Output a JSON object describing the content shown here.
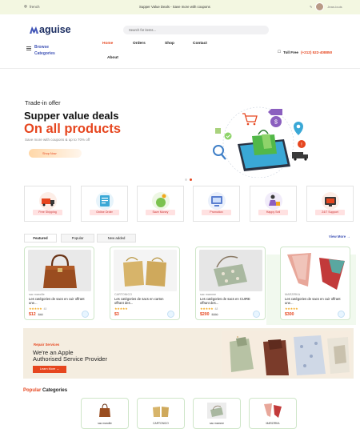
{
  "topbar": {
    "language": "french",
    "promo": "Supper Value Deals - Save more with coupons",
    "user": "Jean-louis"
  },
  "header": {
    "logo_text": "aguise",
    "search_placeholder": "Search for items...",
    "browse_label_1": "Browse",
    "browse_label_2": "Categories",
    "nav": [
      "Home",
      "Orders",
      "Shop",
      "Contact",
      "About"
    ],
    "tollfree_label": "Toll Free",
    "phone": "(+212) 522-408850"
  },
  "hero": {
    "subtitle": "Trade-in offer",
    "heading_1": "Supper value deals",
    "heading_2": "On all products",
    "text": "Save more with coupons & up to 70% off",
    "button": "Shop Now"
  },
  "features": [
    "Free Shipping",
    "Online Order",
    "Save Money",
    "Promotion",
    "Happy Sell",
    "24/7 Support"
  ],
  "tabs": [
    "Featured",
    "Popular",
    "New added"
  ],
  "view_more": "View More →",
  "products": [
    {
      "brand": "sac maroille",
      "name": "Les catégories de sacs en cuir offrant une...",
      "rating": "★★★★★",
      "reviews": "4.5",
      "price": "$12",
      "old_price": "$40"
    },
    {
      "brand": "CARTONICO",
      "name": "Les catégories de sacs en carton offrant des...",
      "rating": "★★★★★",
      "reviews": "",
      "price": "$3",
      "old_price": ""
    },
    {
      "brand": "sac mamme",
      "name": "Les catégories de sacs en CUIRE offrant des...",
      "rating": "★★★★★",
      "reviews": "4.8",
      "price": "$200",
      "old_price": "$250"
    },
    {
      "brand": "MARZIRKA",
      "name": "Les catégories de sacs en cuir offrant une...",
      "rating": "★★★★★",
      "reviews": "",
      "price": "$300",
      "old_price": ""
    }
  ],
  "service": {
    "tag": "Repair Services",
    "line_1": "We're an Apple",
    "line_2": "Authorised Service Provider",
    "button": "Learn More →"
  },
  "categories": {
    "title_highlight": "Popular",
    "title_rest": "Categories",
    "items": [
      "sac maroille",
      "CARTONICO",
      "sac mamme",
      "MARZIRKA"
    ]
  },
  "colors": {
    "accent": "#e6461f",
    "brand": "#1c2e62",
    "link": "#3f53b6",
    "topbar": "#f3f7e1"
  }
}
